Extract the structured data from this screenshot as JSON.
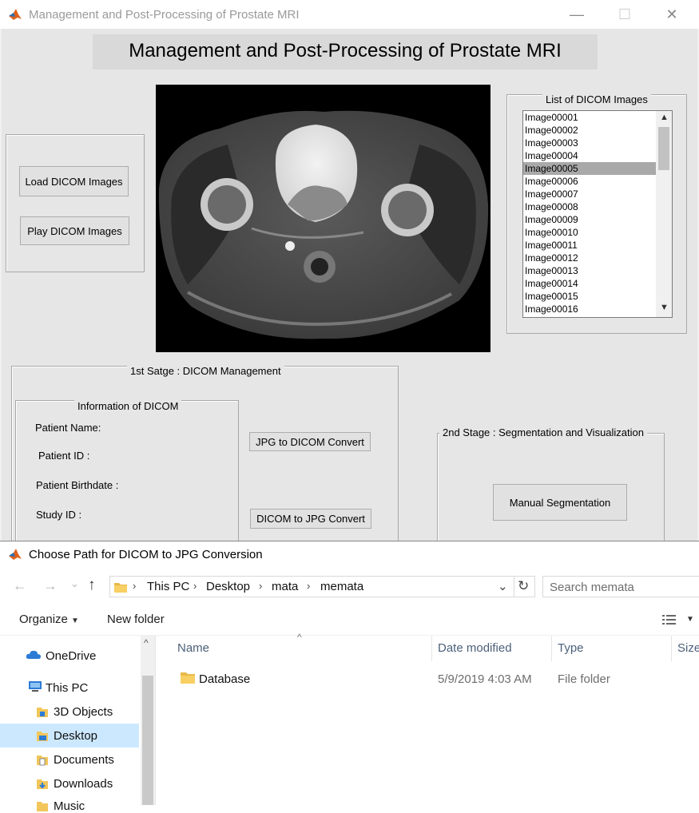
{
  "matlab_window": {
    "title": "Management and Post-Processing  of Prostate MRI",
    "heading": "Management and Post-Processing  of Prostate MRI",
    "controls": {
      "minimize": "—",
      "maximize": "☐",
      "close": "✕"
    },
    "load_button": "Load DICOM Images",
    "play_button": "Play DICOM Images",
    "list_panel": {
      "title": "List of DICOM Images",
      "items": [
        "Image00001",
        "Image00002",
        "Image00003",
        "Image00004",
        "Image00005",
        "Image00006",
        "Image00007",
        "Image00008",
        "Image00009",
        "Image00010",
        "Image00011",
        "Image00012",
        "Image00013",
        "Image00014",
        "Image00015",
        "Image00016"
      ],
      "selected": "Image00005"
    },
    "stage1": {
      "title": "1st Satge : DICOM Management",
      "info_title": "Information of DICOM",
      "patient_name": "Patient Name:",
      "patient_id": "Patient ID :",
      "patient_birthdate": "Patient Birthdate :",
      "study_id": "Study ID :",
      "jpg_to_dicom": "JPG to DICOM Convert",
      "dicom_to_jpg": "DICOM to JPG Convert"
    },
    "stage2": {
      "title": "2nd Stage : Segmentation and Visualization",
      "manual_segmentation": "Manual Segmentation"
    }
  },
  "dialog": {
    "title": "Choose Path for DICOM to JPG Conversion",
    "nav": {
      "back": "←",
      "forward": "→",
      "recent": "⌄",
      "up": "↑"
    },
    "breadcrumb": [
      "This PC",
      "Desktop",
      "mata",
      "memata"
    ],
    "search_placeholder": "Search memata",
    "toolbar": {
      "organize": "Organize",
      "new_folder": "New folder"
    },
    "nav_pane": {
      "onedrive": "OneDrive",
      "this_pc": "This PC",
      "items": [
        "3D Objects",
        "Desktop",
        "Documents",
        "Downloads",
        "Music"
      ],
      "selected": "Desktop"
    },
    "columns": [
      "Name",
      "Date modified",
      "Type",
      "Size"
    ],
    "files": [
      {
        "name": "Database",
        "date": "5/9/2019 4:03 AM",
        "type": "File folder",
        "size": ""
      }
    ],
    "icons": {
      "app": "matlab-icon",
      "folder": "folder-icon",
      "refresh": "refresh-icon",
      "view": "view-options-icon",
      "onedrive": "cloud-icon",
      "pc": "computer-icon"
    }
  }
}
